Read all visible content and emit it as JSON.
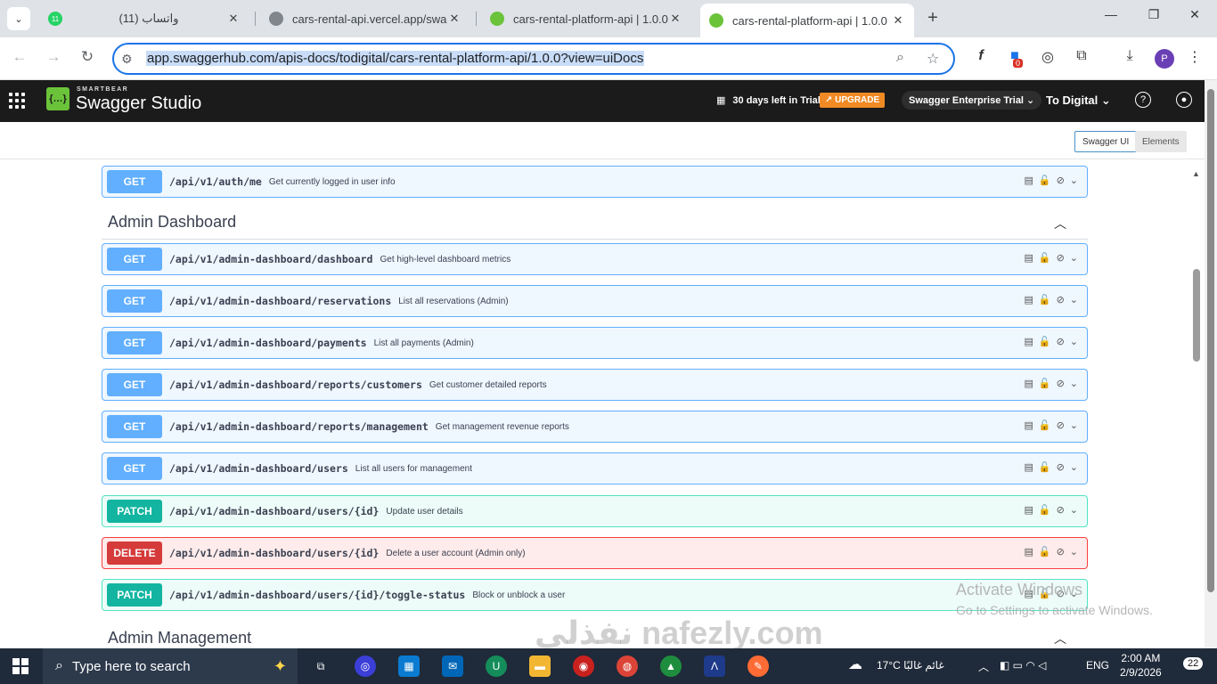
{
  "browser": {
    "tabs": [
      {
        "label": "(11) واتساب",
        "favicon_color": "#25d366",
        "badge": "11"
      },
      {
        "label": "cars-rental-api.vercel.app/swag",
        "favicon_color": "#5f6368"
      },
      {
        "label": "cars-rental-platform-api | 1.0.0",
        "favicon_color": "#6bc33a"
      },
      {
        "label": "cars-rental-platform-api | 1.0.0",
        "favicon_color": "#6bc33a",
        "active": true
      }
    ],
    "url": "app.swaggerhub.com/apis-docs/todigital/cars-rental-platform-api/1.0.0?view=uiDocs",
    "extension_badge": "0",
    "profile_initial": "P"
  },
  "swagger_header": {
    "brand_top": "SMARTBEAR",
    "brand": "Swagger Studio",
    "trial_text": "30 days left in Trial",
    "upgrade_label": "↗ UPGRADE",
    "enterprise_label": "Swagger Enterprise Trial ⌄",
    "org_label": "To Digital ⌄"
  },
  "view_toggle": {
    "swagger_ui": "Swagger UI",
    "elements": "Elements"
  },
  "sections": [
    {
      "title": "Admin Dashboard"
    },
    {
      "title": "Admin Management"
    }
  ],
  "operations": [
    {
      "method": "GET",
      "path": "/api/v1/auth/me",
      "summary": "Get currently logged in user info"
    },
    {
      "method": "GET",
      "path": "/api/v1/admin-dashboard/dashboard",
      "summary": "Get high-level dashboard metrics"
    },
    {
      "method": "GET",
      "path": "/api/v1/admin-dashboard/reservations",
      "summary": "List all reservations (Admin)"
    },
    {
      "method": "GET",
      "path": "/api/v1/admin-dashboard/payments",
      "summary": "List all payments (Admin)"
    },
    {
      "method": "GET",
      "path": "/api/v1/admin-dashboard/reports/customers",
      "summary": "Get customer detailed reports"
    },
    {
      "method": "GET",
      "path": "/api/v1/admin-dashboard/reports/management",
      "summary": "Get management revenue reports"
    },
    {
      "method": "GET",
      "path": "/api/v1/admin-dashboard/users",
      "summary": "List all users for management"
    },
    {
      "method": "PATCH",
      "path": "/api/v1/admin-dashboard/users/{id}",
      "summary": "Update user details"
    },
    {
      "method": "DELETE",
      "path": "/api/v1/admin-dashboard/users/{id}",
      "summary": "Delete a user account (Admin only)"
    },
    {
      "method": "PATCH",
      "path": "/api/v1/admin-dashboard/users/{id}/toggle-status",
      "summary": "Block or unblock a user"
    }
  ],
  "overlay": {
    "activate_title": "Activate Windows",
    "activate_sub": "Go to Settings to activate Windows.",
    "watermark": "نفذلي nafezly.com"
  },
  "taskbar": {
    "search_placeholder": "Type here to search",
    "weather": "17°C  غائم غالبًا",
    "lang": "ENG",
    "time": "2:00 AM",
    "date": "2/9/2026",
    "notifications": "22"
  }
}
